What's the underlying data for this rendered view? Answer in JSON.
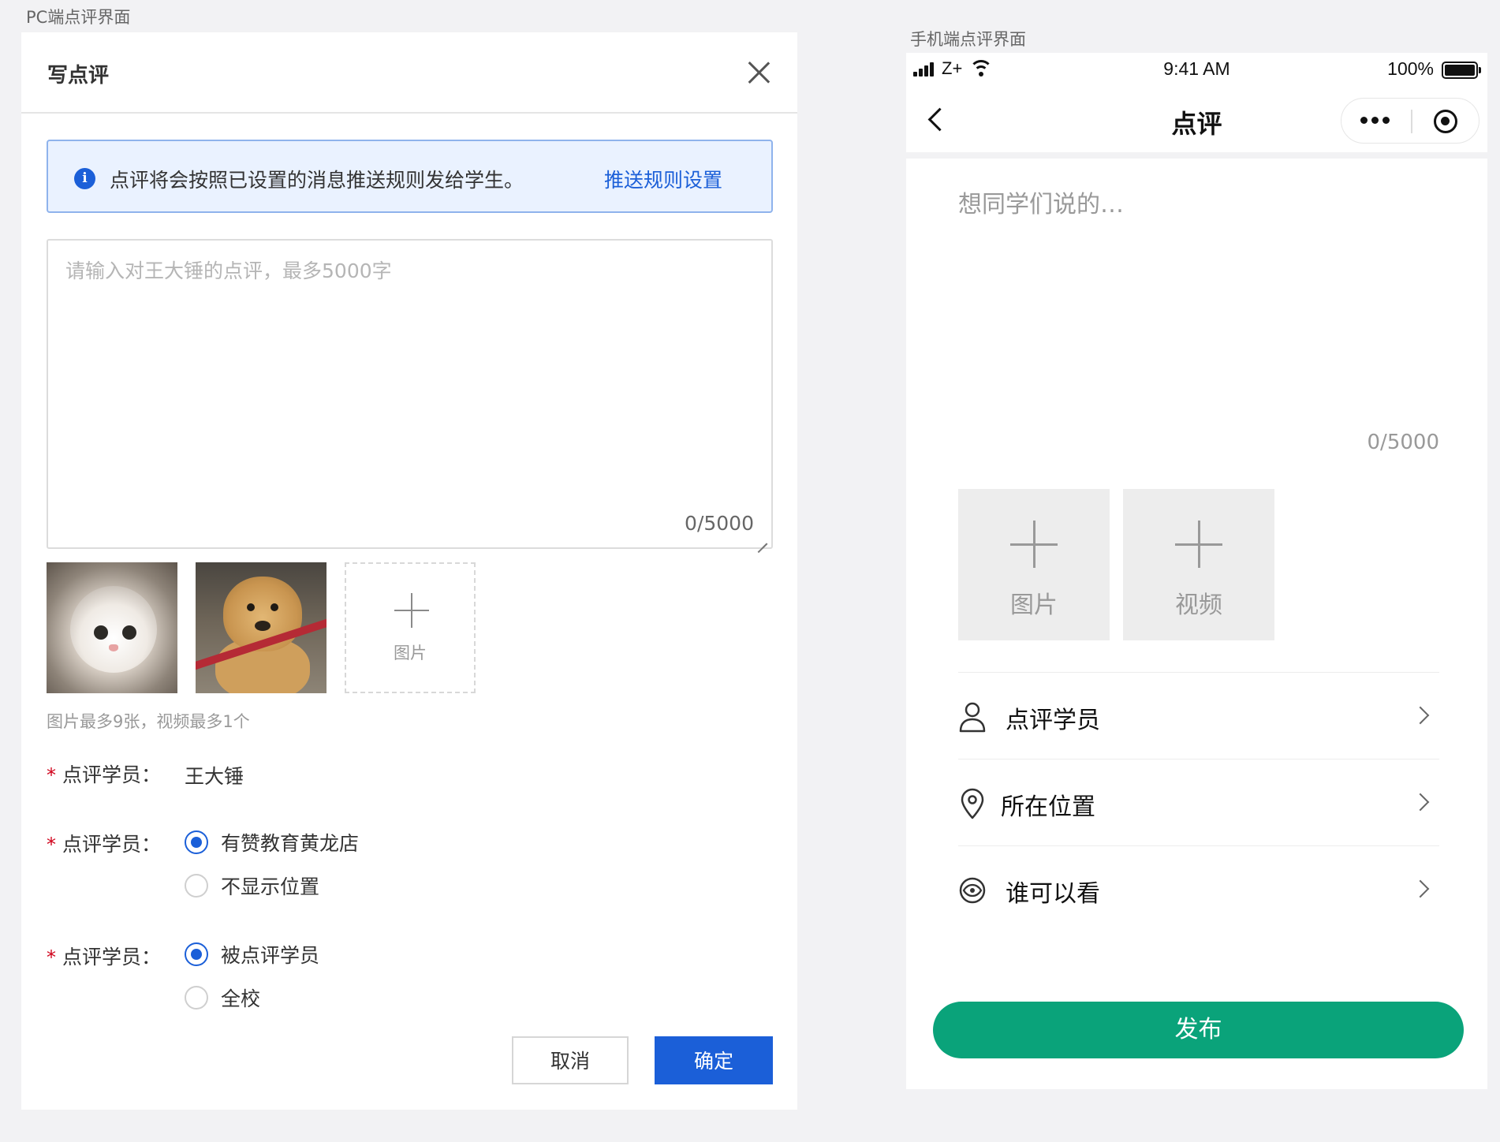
{
  "captions": {
    "pc": "PC端点评界面",
    "mobile": "手机端点评界面"
  },
  "pc": {
    "title": "写点评",
    "notice": {
      "message": "点评将会按照已设置的消息推送规则发给学生。",
      "link": "推送规则设置"
    },
    "textarea": {
      "placeholder": "请输入对王大锤的点评，最多5000字",
      "counter": "0/5000"
    },
    "add_image_label": "图片",
    "upload_hint": "图片最多9张，视频最多1个",
    "fields": [
      {
        "label": "点评学员：",
        "value": "王大锤"
      },
      {
        "label": "点评学员：",
        "options": [
          {
            "text": "有赞教育黄龙店",
            "selected": true
          },
          {
            "text": "不显示位置",
            "selected": false
          }
        ]
      },
      {
        "label": "点评学员：",
        "options": [
          {
            "text": "被点评学员",
            "selected": true
          },
          {
            "text": "全校",
            "selected": false
          }
        ]
      }
    ],
    "required_mark": "*",
    "cancel_label": "取消",
    "confirm_label": "确定",
    "primary_color": "#1b5fd8"
  },
  "mobile": {
    "status": {
      "carrier": "Z+",
      "time": "9:41 AM",
      "battery": "100%"
    },
    "nav_title": "点评",
    "input_placeholder": "想同学们说的…",
    "counter": "0/5000",
    "tiles": [
      {
        "label": "图片"
      },
      {
        "label": "视频"
      }
    ],
    "list": [
      {
        "icon": "user-icon",
        "label": "点评学员"
      },
      {
        "icon": "location-pin-icon",
        "label": "所在位置"
      },
      {
        "icon": "eye-icon",
        "label": "谁可以看"
      }
    ],
    "publish_label": "发布",
    "accent_color": "#0aa37a"
  }
}
